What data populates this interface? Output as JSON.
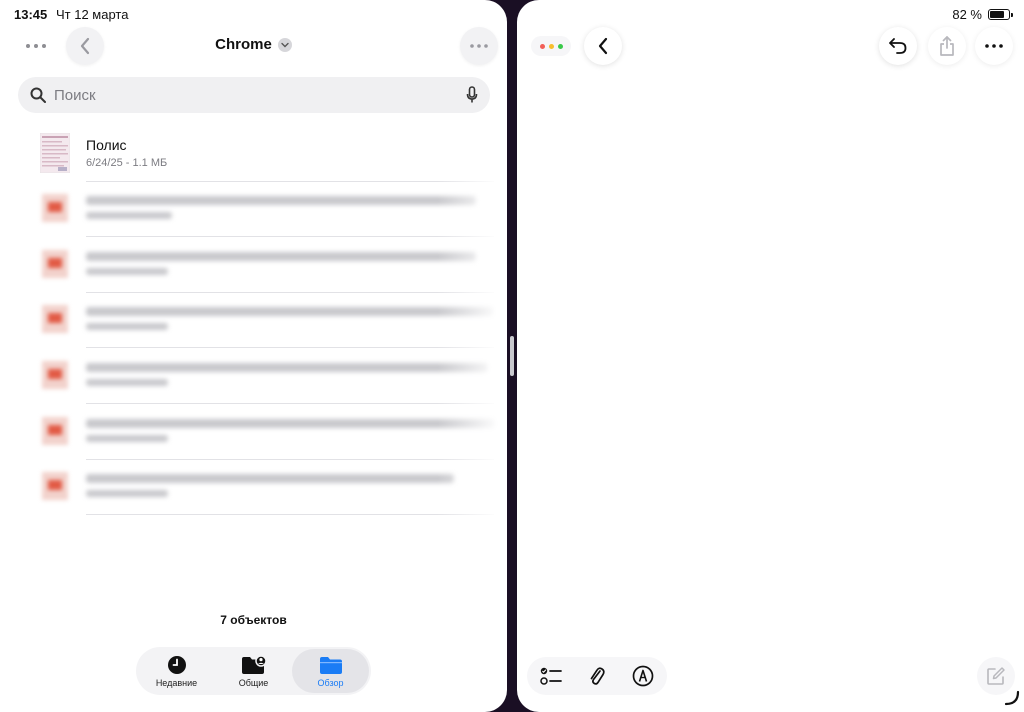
{
  "status_bar": {
    "time": "13:45",
    "date": "Чт 12 марта",
    "battery_text": "82 %",
    "battery_level": 0.82
  },
  "files_app": {
    "title": "Chrome",
    "search": {
      "placeholder": "Поиск"
    },
    "items": [
      {
        "name": "Полис",
        "meta": "6/24/25 - 1.1 МБ"
      }
    ],
    "count_label": "7 объектов",
    "tabs": [
      {
        "label": "Недавние",
        "icon": "clock-icon",
        "active": false
      },
      {
        "label": "Общие",
        "icon": "shared-folder-icon",
        "active": false
      },
      {
        "label": "Обзор",
        "icon": "folder-icon",
        "active": true
      }
    ],
    "colors": {
      "accent": "#1a7cf5"
    }
  },
  "notes_app": {
    "icons": [
      "undo-icon",
      "share-icon",
      "more-icon",
      "checklist-icon",
      "paperclip-icon",
      "markup-icon",
      "compose-icon"
    ],
    "traffic_colors": [
      "#f25f58",
      "#f7be2d",
      "#3ac94a"
    ]
  }
}
